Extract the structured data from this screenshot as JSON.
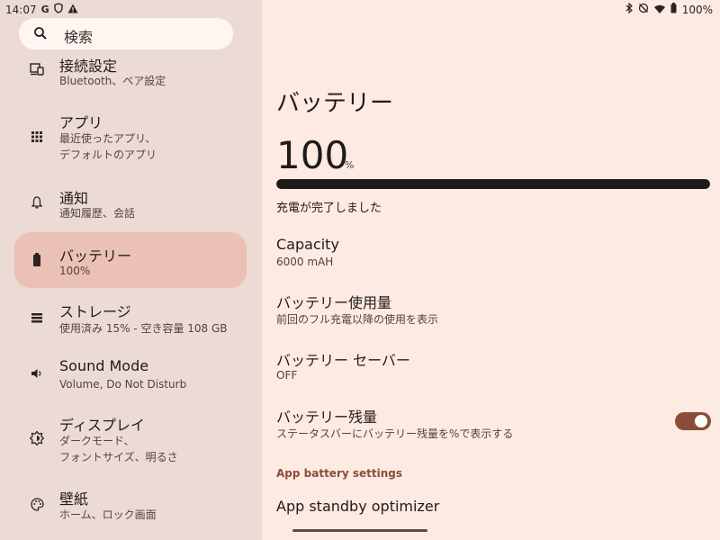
{
  "status_bar": {
    "time": "14:07",
    "left_icons": [
      "google-g-icon",
      "vpn-shield-icon",
      "warning-icon"
    ],
    "right_icons": [
      "bluetooth-icon",
      "do-not-disturb-off-icon",
      "wifi-icon",
      "battery-icon"
    ],
    "battery_text": "100%"
  },
  "search": {
    "placeholder": "検索"
  },
  "nav": {
    "items": [
      {
        "icon": "connected-devices-icon",
        "title": "接続設定",
        "subtitle": [
          "Bluetooth、ペア設定"
        ]
      },
      {
        "icon": "apps-grid-icon",
        "title": "アプリ",
        "subtitle": [
          "最近使ったアプリ、",
          "デフォルトのアプリ"
        ]
      },
      {
        "icon": "bell-icon",
        "title": "通知",
        "subtitle": [
          "通知履歴、会話"
        ]
      },
      {
        "icon": "battery-icon",
        "title": "バッテリー",
        "subtitle": [
          "100%"
        ],
        "selected": true
      },
      {
        "icon": "storage-icon",
        "title": "ストレージ",
        "subtitle": [
          "使用済み 15% - 空き容量 108 GB"
        ]
      },
      {
        "icon": "volume-icon",
        "title": "Sound Mode",
        "subtitle": [
          "Volume, Do Not Disturb"
        ]
      },
      {
        "icon": "brightness-icon",
        "title": "ディスプレイ",
        "subtitle": [
          "ダークモード、",
          "フォントサイズ、明るさ"
        ]
      },
      {
        "icon": "palette-icon",
        "title": "壁紙",
        "subtitle": [
          "ホーム、ロック画面"
        ]
      }
    ]
  },
  "main": {
    "title": "バッテリー",
    "level_value": "100",
    "level_unit": "%",
    "level_fraction": 1.0,
    "charge_status": "充電が完了しました",
    "prefs": [
      {
        "title": "Capacity",
        "subtitle": "6000 mAH"
      },
      {
        "title": "バッテリー使用量",
        "subtitle": "前回のフル充電以降の使用を表示"
      },
      {
        "title": "バッテリー セーバー",
        "subtitle": "OFF"
      },
      {
        "title": "バッテリー残量",
        "subtitle": "ステータスバーにバッテリー残量を%で表示する",
        "toggle_on": true
      }
    ],
    "section_header": "App battery settings",
    "standby_title": "App standby optimizer"
  },
  "colors": {
    "accent": "#8b4d39",
    "selected_bg": "#eac1b4",
    "left_pane_bg": "#ecdbd5",
    "right_pane_bg": "#fdeae3"
  }
}
